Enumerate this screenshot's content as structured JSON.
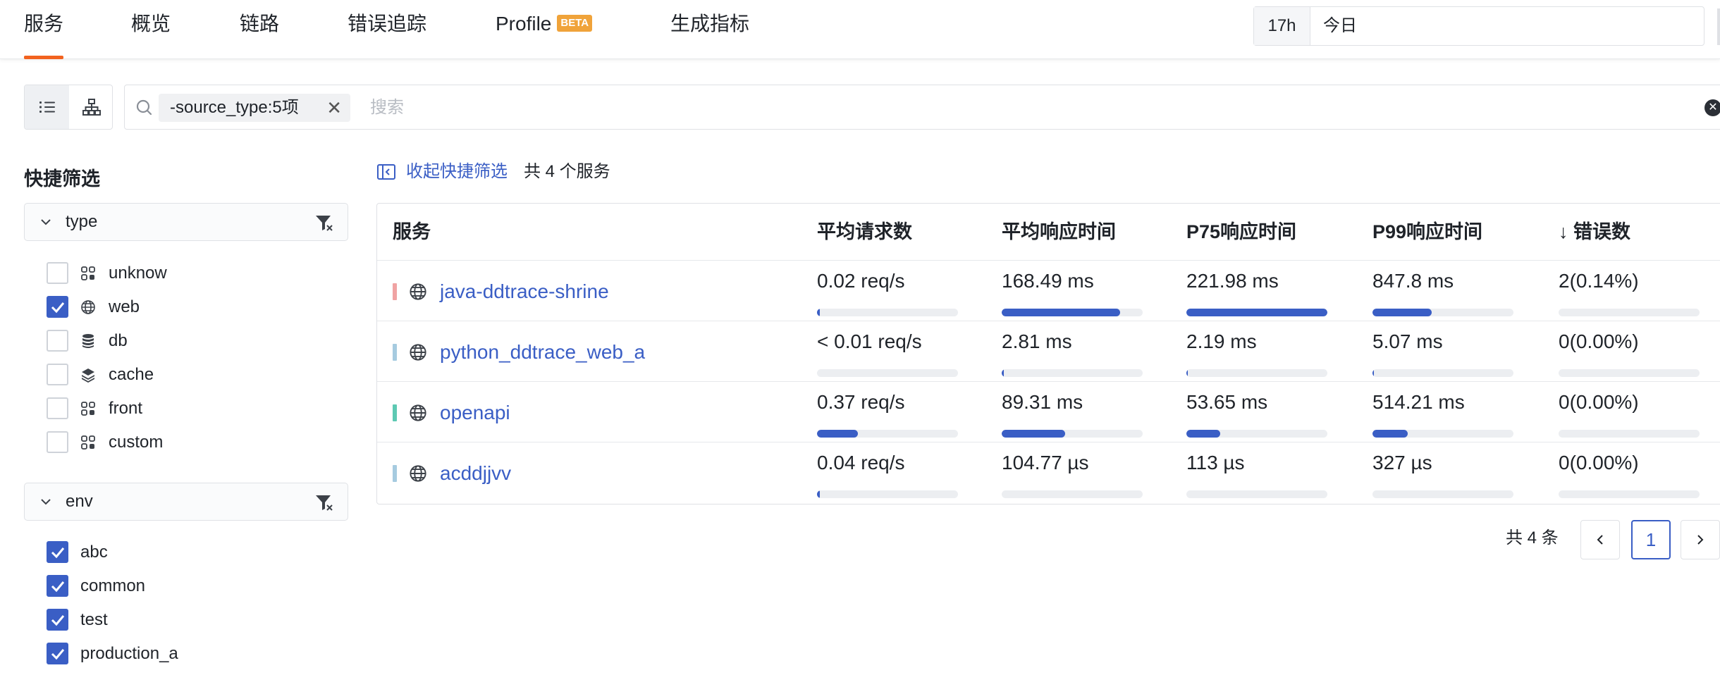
{
  "tabs": [
    {
      "label": "服务",
      "active": true
    },
    {
      "label": "概览",
      "active": false
    },
    {
      "label": "链路",
      "active": false
    },
    {
      "label": "错误追踪",
      "active": false
    },
    {
      "label": "Profile",
      "badge": "BETA",
      "active": false
    },
    {
      "label": "生成指标",
      "active": false
    }
  ],
  "time_range": {
    "prefix": "17h",
    "value": "今日"
  },
  "search": {
    "filter_chip": "-source_type:5项",
    "placeholder": "搜索"
  },
  "sidebar": {
    "title": "快捷筛选",
    "facets": [
      {
        "name": "type",
        "items": [
          {
            "label": "unknow",
            "checked": false,
            "icon": "grid-icon"
          },
          {
            "label": "web",
            "checked": true,
            "icon": "globe-icon"
          },
          {
            "label": "db",
            "checked": false,
            "icon": "database-icon"
          },
          {
            "label": "cache",
            "checked": false,
            "icon": "layers-icon"
          },
          {
            "label": "front",
            "checked": false,
            "icon": "grid-icon"
          },
          {
            "label": "custom",
            "checked": false,
            "icon": "grid-icon"
          }
        ]
      },
      {
        "name": "env",
        "items": [
          {
            "label": "abc",
            "checked": true
          },
          {
            "label": "common",
            "checked": true
          },
          {
            "label": "test",
            "checked": true
          },
          {
            "label": "production_a",
            "checked": true
          }
        ]
      }
    ]
  },
  "content": {
    "collapse_label": "收起快捷筛选",
    "total_label": "共 4 个服务"
  },
  "table": {
    "columns": [
      "服务",
      "平均请求数",
      "平均响应时间",
      "P75响应时间",
      "P99响应时间",
      "↓ 错误数"
    ],
    "rows": [
      {
        "name": "java-ddtrace-shrine",
        "color": "#f0a3a3",
        "avg_req": {
          "value": "0.02 req/s",
          "fraction": 0.02
        },
        "avg_resp": {
          "value": "168.49 ms",
          "fraction": 0.84
        },
        "p75": {
          "value": "221.98 ms",
          "fraction": 1.0
        },
        "p99": {
          "value": "847.8 ms",
          "fraction": 0.42
        },
        "errors": {
          "value": "2(0.14%)",
          "fraction": 0
        }
      },
      {
        "name": "python_ddtrace_web_a",
        "color": "#a6cbe0",
        "avg_req": {
          "value": "< 0.01 req/s",
          "fraction": 0
        },
        "avg_resp": {
          "value": "2.81 ms",
          "fraction": 0.015
        },
        "p75": {
          "value": "2.19 ms",
          "fraction": 0.01
        },
        "p99": {
          "value": "5.07 ms",
          "fraction": 0.006
        },
        "errors": {
          "value": "0(0.00%)",
          "fraction": 0
        }
      },
      {
        "name": "openapi",
        "color": "#5dc9b3",
        "avg_req": {
          "value": "0.37 req/s",
          "fraction": 0.29
        },
        "avg_resp": {
          "value": "89.31 ms",
          "fraction": 0.45
        },
        "p75": {
          "value": "53.65 ms",
          "fraction": 0.24
        },
        "p99": {
          "value": "514.21 ms",
          "fraction": 0.25
        },
        "errors": {
          "value": "0(0.00%)",
          "fraction": 0
        }
      },
      {
        "name": "acddjjvv",
        "color": "#a6cbe0",
        "avg_req": {
          "value": "0.04 req/s",
          "fraction": 0.02
        },
        "avg_resp": {
          "value": "104.77 µs",
          "fraction": 0
        },
        "p75": {
          "value": "113 µs",
          "fraction": 0
        },
        "p99": {
          "value": "327 µs",
          "fraction": 0
        },
        "errors": {
          "value": "0(0.00%)",
          "fraction": 0
        }
      }
    ]
  },
  "pagination": {
    "total_label": "共 4 条",
    "current_page": "1"
  }
}
